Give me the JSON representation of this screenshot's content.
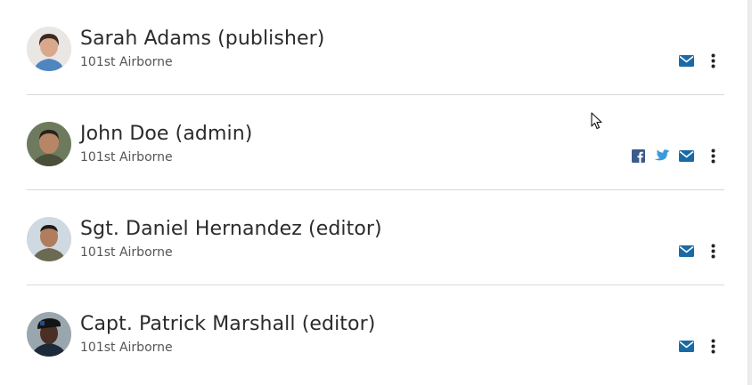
{
  "users": [
    {
      "name": "Sarah Adams (publisher)",
      "unit": "101st Airborne",
      "avatar": "sarah-adams-avatar",
      "actions": [
        "email-icon",
        "more-vertical-icon"
      ]
    },
    {
      "name": "John Doe (admin)",
      "unit": "101st Airborne",
      "avatar": "john-doe-avatar",
      "actions": [
        "facebook-icon",
        "twitter-icon",
        "email-icon",
        "more-vertical-icon"
      ]
    },
    {
      "name": "Sgt. Daniel Hernandez (editor)",
      "unit": "101st Airborne",
      "avatar": "daniel-hernandez-avatar",
      "actions": [
        "email-icon",
        "more-vertical-icon"
      ]
    },
    {
      "name": "Capt. Patrick Marshall (editor)",
      "unit": "101st Airborne",
      "avatar": "patrick-marshall-avatar",
      "actions": [
        "email-icon",
        "more-vertical-icon"
      ]
    }
  ],
  "colors": {
    "icon_blue": "#1a6aa6",
    "facebook": "#3b5b8c",
    "twitter": "#3b9ad9",
    "divider": "#d9d9d9",
    "name_text": "#2b2b2b",
    "unit_text": "#555555"
  }
}
